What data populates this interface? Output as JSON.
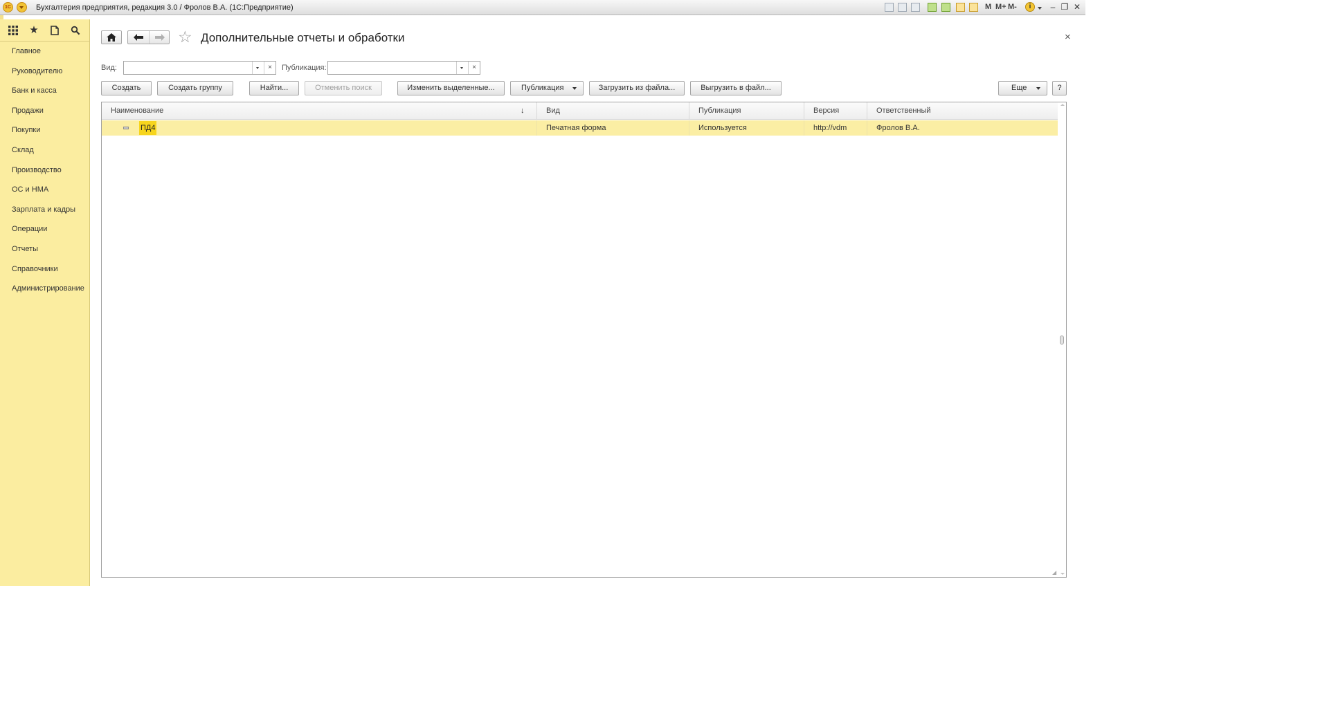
{
  "window": {
    "title": "Бухгалтерия предприятия, редакция 3.0 / Фролов В.А.  (1С:Предприятие)",
    "logo_text": "1С",
    "info_glyph": "i",
    "letter_m": "M",
    "letter_mplus": "M+",
    "letter_mminus": "M-"
  },
  "sidebar": {
    "sections": [
      {
        "label": "Главное"
      },
      {
        "label": "Руководителю"
      },
      {
        "label": "Банк и касса"
      },
      {
        "label": "Продажи"
      },
      {
        "label": "Покупки"
      },
      {
        "label": "Склад"
      },
      {
        "label": "Производство"
      },
      {
        "label": "ОС и НМА"
      },
      {
        "label": "Зарплата и кадры"
      },
      {
        "label": "Операции"
      },
      {
        "label": "Отчеты"
      },
      {
        "label": "Справочники"
      },
      {
        "label": "Администрирование"
      }
    ]
  },
  "form": {
    "title": "Дополнительные отчеты и обработки",
    "close_glyph": "×"
  },
  "filters": {
    "vid_label": "Вид:",
    "vid_value": "",
    "publication_label": "Публикация:",
    "publication_value": "",
    "clear_glyph": "×"
  },
  "toolbar": {
    "create": "Создать",
    "create_group": "Создать группу",
    "find": "Найти...",
    "cancel_search": "Отменить поиск",
    "change_selected": "Изменить выделенные...",
    "publication": "Публикация",
    "load_from_file": "Загрузить из файла...",
    "export_to_file": "Выгрузить в файл...",
    "more": "Еще",
    "help": "?"
  },
  "table": {
    "sort_glyph": "↓",
    "columns": [
      {
        "label": "Наименование"
      },
      {
        "label": "Вид"
      },
      {
        "label": "Публикация"
      },
      {
        "label": "Версия"
      },
      {
        "label": "Ответственный"
      }
    ],
    "rows": [
      {
        "name": "ПД4",
        "vid": "Печатная форма",
        "publication": "Используется",
        "version": "http://vdm",
        "responsible": "Фролов В.А."
      }
    ]
  },
  "colors": {
    "sidebar_bg": "#fbeda0",
    "selected_row": "#fbeea4",
    "current_cell": "#f7d51d"
  }
}
